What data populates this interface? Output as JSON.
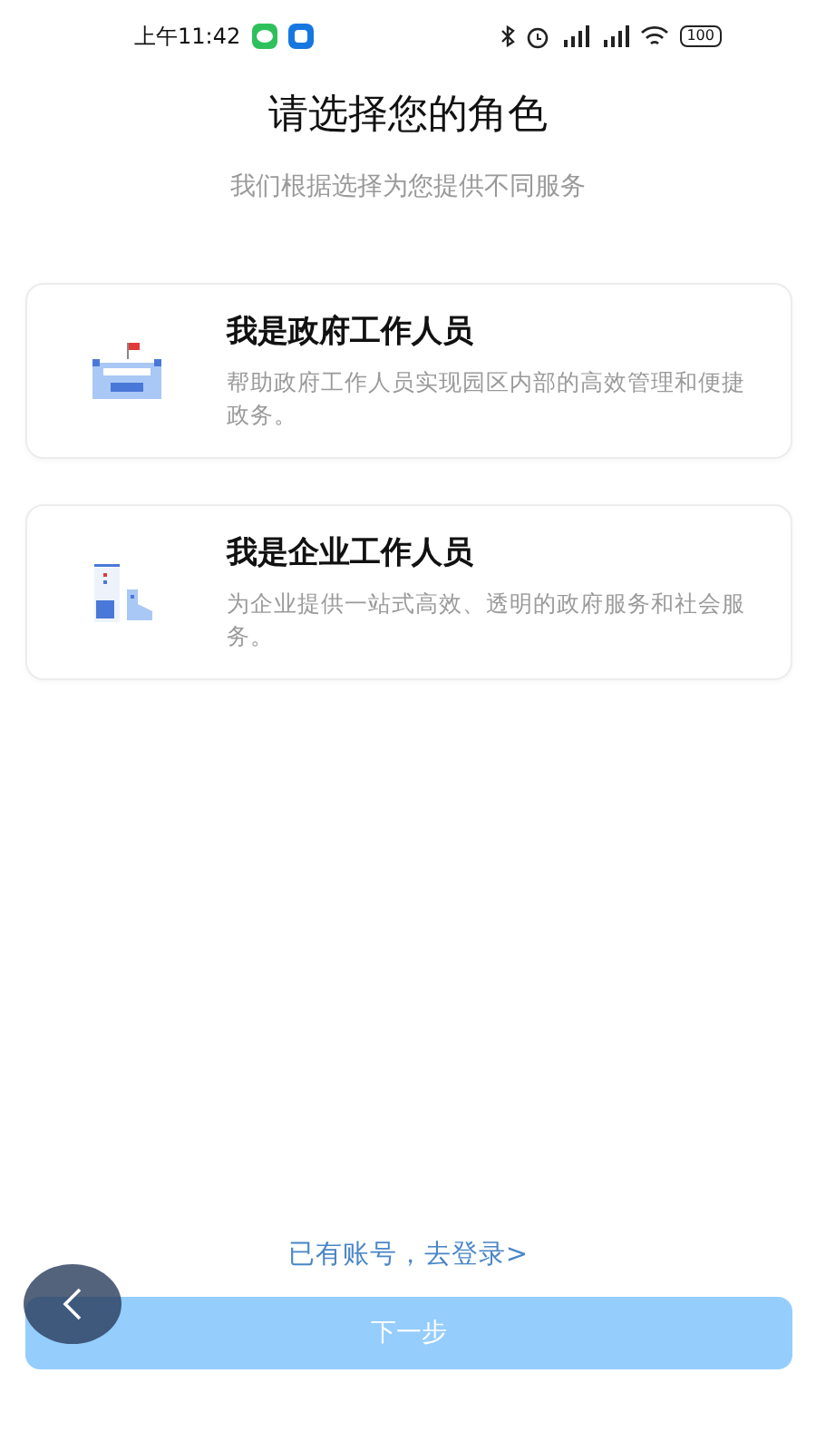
{
  "status_bar": {
    "time": "上午11:42",
    "battery": "100"
  },
  "title": "请选择您的角色",
  "subtitle": "我们根据选择为您提供不同服务",
  "roles": [
    {
      "kind": "government",
      "title": "我是政府工作人员",
      "description": "帮助政府工作人员实现园区内部的高效管理和便捷政务。",
      "selected": false
    },
    {
      "kind": "enterprise",
      "title": "我是企业工作人员",
      "description": "为企业提供一站式高效、透明的政府服务和社会服务。",
      "selected": false
    }
  ],
  "login_link": "已有账号，去登录>",
  "next_button": {
    "label": "下一步",
    "disabled": true
  }
}
